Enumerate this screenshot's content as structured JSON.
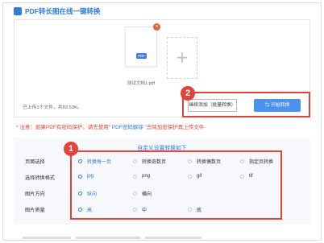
{
  "header": {
    "title": "PDF转长图在线一键转换"
  },
  "upload": {
    "file_name": "测试文档1.pdf",
    "pdf_badge": "PDF",
    "close_icon": "close-icon",
    "add_icon": "plus-icon",
    "files_count": "已上传1个文件，共83.53K。",
    "continue_button": "继续添加（批量转换）",
    "start_button": "开始转换"
  },
  "notice": {
    "prefix": "注意：如果PDF有密码保护，请先使用",
    "link": "“ PDF密码解除 ”",
    "suffix": "去除加密保护再上传文件"
  },
  "settings": {
    "title": "自定义设置转换如下",
    "rows": [
      {
        "label": "页面选择",
        "options": [
          "转换每一页",
          "转换奇数页",
          "转换偶数页",
          "指定页转换"
        ],
        "selected": 0
      },
      {
        "label": "选择转换格式",
        "options": [
          "jpg",
          "png",
          "gif",
          "tif"
        ],
        "selected": 0
      },
      {
        "label": "图片方向",
        "options": [
          "纵向",
          "横向"
        ],
        "selected": 0
      },
      {
        "label": "图片质量",
        "options": [
          "高",
          "中",
          "底"
        ],
        "selected": 0
      }
    ]
  },
  "annotations": {
    "badge_1": "1",
    "badge_2": "2"
  },
  "colors": {
    "accent": "#2f7de1",
    "annotation_red": "#e5433a",
    "primary_button": "#4c93f0"
  }
}
